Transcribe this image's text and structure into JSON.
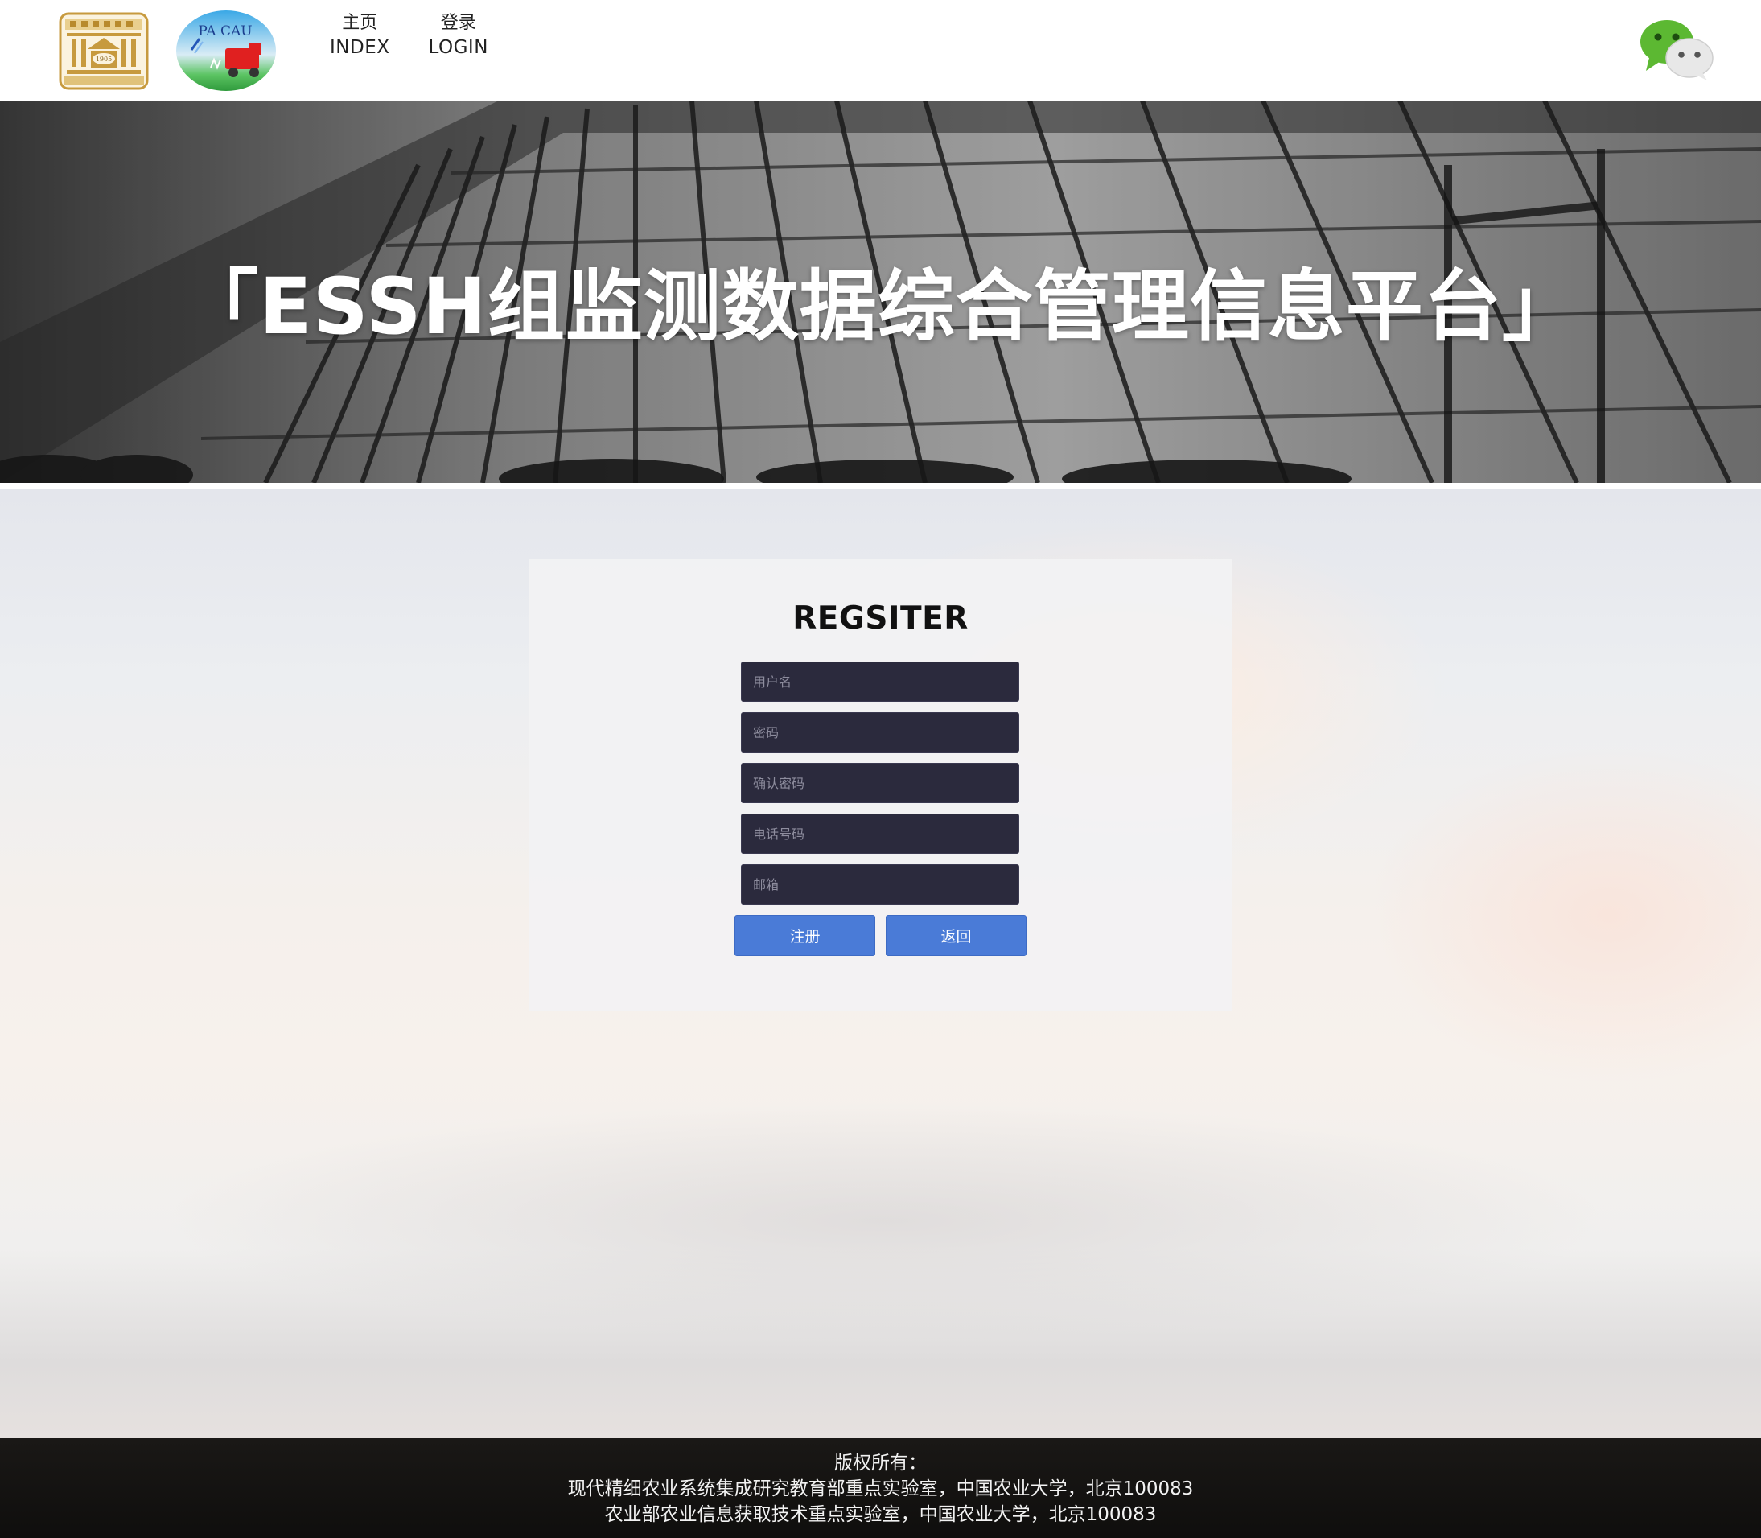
{
  "header": {
    "logo_cau_year": "1905",
    "logo_pacau_text": "PA  CAU",
    "nav": [
      {
        "cn": "主页",
        "en": "INDEX"
      },
      {
        "cn": "登录",
        "en": "LOGIN"
      }
    ],
    "wechat_icon": "wechat-icon"
  },
  "banner": {
    "title": "「ESSH组监测数据综合管理信息平台」"
  },
  "register": {
    "title": "REGSITER",
    "fields": {
      "username_placeholder": "用户名",
      "password_placeholder": "密码",
      "confirm_placeholder": "确认密码",
      "phone_placeholder": "电话号码",
      "email_placeholder": "邮箱"
    },
    "submit_label": "注册",
    "back_label": "返回"
  },
  "footer": {
    "line1": "版权所有：",
    "line2": "现代精细农业系统集成研究教育部重点实验室，中国农业大学，北京100083",
    "line3": "农业部农业信息获取技术重点实验室，中国农业大学，北京100083"
  },
  "colors": {
    "input_bg": "#2b2a3d",
    "button_bg": "#4a7bd7",
    "footer_bg": "#1a1816"
  }
}
